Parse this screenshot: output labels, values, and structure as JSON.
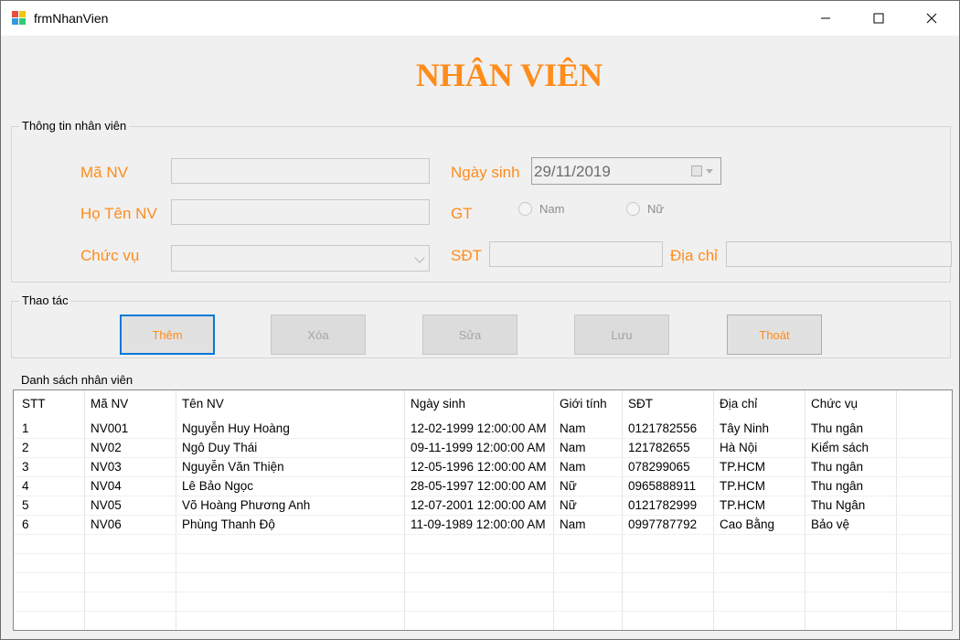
{
  "window": {
    "title": "frmNhanVien",
    "controls": [
      "minimize-icon",
      "maximize-icon",
      "close-icon"
    ]
  },
  "form_title": "NHÂN VIÊN",
  "info_group": {
    "caption": "Thông tin nhân viên",
    "ma_nv_label": "Mã NV",
    "ma_nv_value": "",
    "ho_ten_label": "Họ Tên NV",
    "ho_ten_value": "",
    "chuc_vu_label": "Chức vụ",
    "chuc_vu_value": "",
    "ngay_sinh_label": "Ngày sinh",
    "ngay_sinh_value": "29/11/2019",
    "gt_label": "GT",
    "gender_options": [
      "Nam",
      "Nữ"
    ],
    "sdt_label": "SĐT",
    "sdt_value": "",
    "dia_chi_label": "Địa chỉ",
    "dia_chi_value": ""
  },
  "actions_group": {
    "caption": "Thao tác",
    "buttons": [
      "Thêm",
      "Xóa",
      "Sửa",
      "Lưu",
      "Thoát"
    ]
  },
  "list_group": {
    "caption": "Danh sách nhân viên",
    "columns": [
      "STT",
      "Mã NV",
      "Tên NV",
      "Ngày sinh",
      "Giới tính",
      "SĐT",
      "Địa chỉ",
      "Chức vụ"
    ],
    "rows": [
      [
        "1",
        "NV001",
        "Nguyễn Huy Hoàng",
        "12-02-1999 12:00:00 AM",
        "Nam",
        "0121782556",
        "Tây Ninh",
        "Thu ngân"
      ],
      [
        "2",
        "NV02",
        "Ngô Duy Thái",
        "09-11-1999 12:00:00 AM",
        "Nam",
        "121782655",
        "Hà Nội",
        "Kiểm sách"
      ],
      [
        "3",
        "NV03",
        "Nguyễn Văn Thiện",
        "12-05-1996 12:00:00 AM",
        "Nam",
        "078299065",
        "TP.HCM",
        "Thu ngân"
      ],
      [
        "4",
        "NV04",
        "Lê Bảo Ngọc",
        "28-05-1997 12:00:00 AM",
        "Nữ",
        "0965888911",
        "TP.HCM",
        "Thu ngân"
      ],
      [
        "5",
        "NV05",
        "Võ Hoàng Phương Anh",
        "12-07-2001 12:00:00 AM",
        "Nữ",
        "0121782999",
        "TP.HCM",
        "Thu Ngân"
      ],
      [
        "6",
        "NV06",
        "Phùng Thanh Độ",
        "11-09-1989 12:00:00 AM",
        "Nam",
        "0997787792",
        "Cao Bằng",
        "Bảo vệ"
      ]
    ]
  },
  "colors": {
    "accent_orange": "#ff8c1a",
    "focus_blue": "#0078d7"
  }
}
